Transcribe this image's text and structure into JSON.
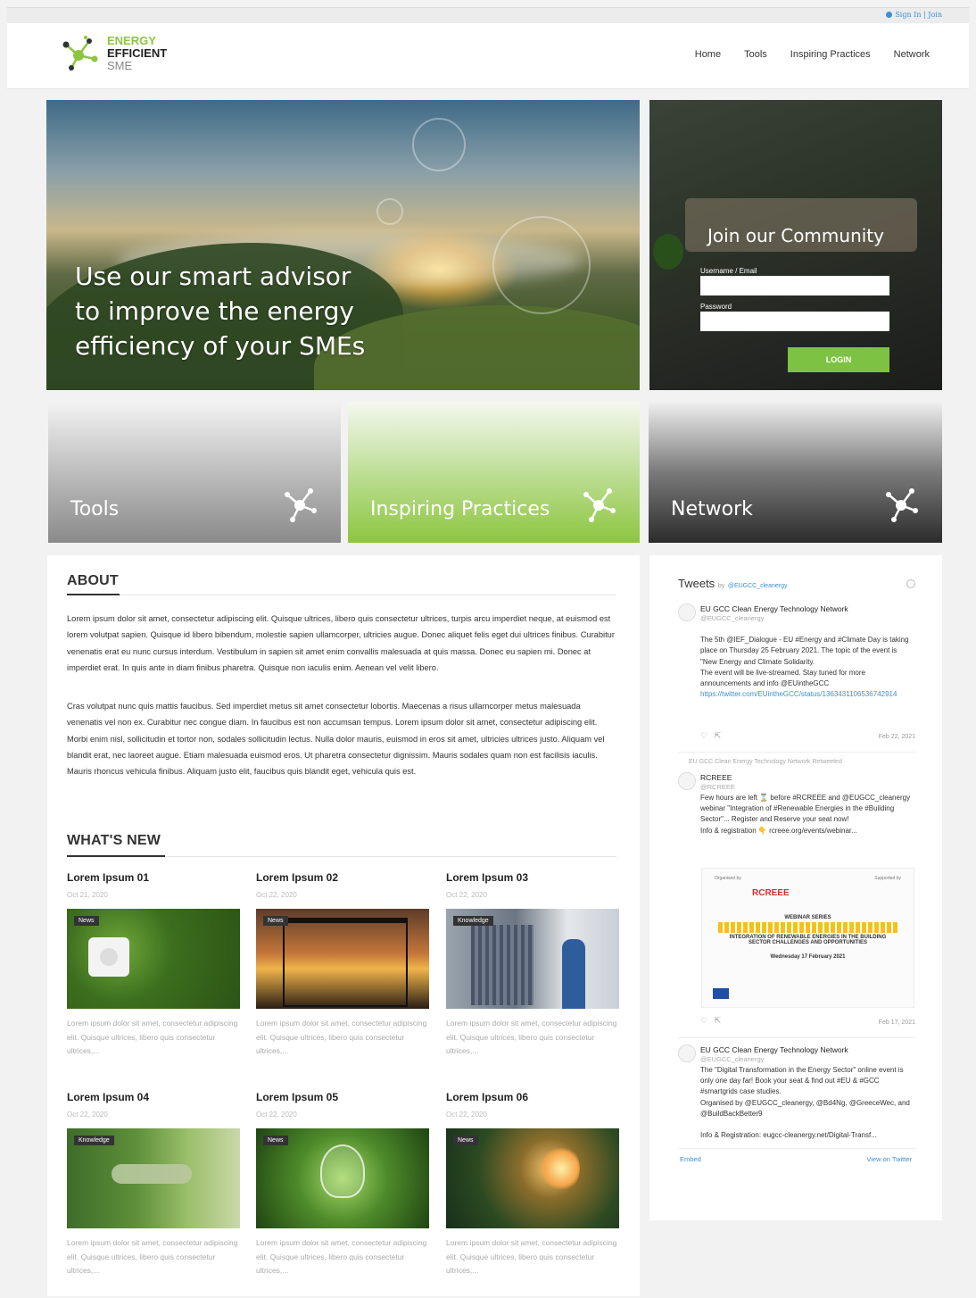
{
  "topbar": {
    "signin": "Sign In | Join"
  },
  "logo": {
    "line1": "ENERGY",
    "line2": "EFFICIENT",
    "line3": "SME"
  },
  "nav": [
    "Home",
    "Tools",
    "Inspiring Practices",
    "Network"
  ],
  "hero": {
    "text": "Use our smart advisor\nto improve the energy\nefficiency of your SMEs"
  },
  "join": {
    "title": "Join our Community",
    "username_label": "Username / Email",
    "password_label": "Password",
    "login": "LOGIN"
  },
  "tiles": [
    "Tools",
    "Inspiring Practices",
    "Network"
  ],
  "about": {
    "title": "ABOUT",
    "p1": "Lorem ipsum dolor sit amet, consectetur adipiscing elit. Quisque ultrices, libero quis consectetur ultrices, turpis arcu imperdiet neque, at euismod est lorem volutpat sapien. Quisque id libero bibendum, molestie sapien ullamcorper, ultricies augue. Donec aliquet felis eget dui ultrices finibus. Curabitur venenatis erat eu nunc cursus interdum. Vestibulum in sapien sit amet enim convallis malesuada at quis massa. Donec eu sapien mi. Donec at imperdiet erat. In quis ante in diam finibus pharetra. Quisque non iaculis enim. Aenean vel velit libero.",
    "p2": "Cras volutpat nunc quis mattis faucibus. Sed imperdiet metus sit amet consectetur lobortis. Maecenas a risus ullamcorper metus malesuada venenatis vel non ex. Curabitur nec congue diam. In faucibus est non accumsan tempus. Lorem ipsum dolor sit amet, consectetur adipiscing elit. Morbi enim nisl, sollicitudin et tortor non, sodales sollicitudin lectus. Nulla dolor mauris, euismod in eros sit amet, ultricies ultrices justo. Aliquam vel blandit erat, nec laoreet augue. Etiam malesuada euismod eros. Ut pharetra consectetur dignissim. Mauris sodales quam non est facilisis iaculis. Mauris rhoncus vehicula finibus. Aliquam justo elit, faucibus quis blandit eget, vehicula quis est."
  },
  "whats_new": {
    "title": "WHAT'S NEW",
    "items": [
      {
        "title": "Lorem Ipsum 01",
        "date": "Oct 21, 2020",
        "tag": "News",
        "text": "Lorem ipsum dolor sit amet, consectetur adipiscing elit. Quisque ultrices, libero quis consectetur ultrices,..."
      },
      {
        "title": "Lorem Ipsum 02",
        "date": "Oct 22, 2020",
        "tag": "News",
        "text": "Lorem ipsum dolor sit amet, consectetur adipiscing elit. Quisque ultrices, libero quis consectetur ultrices,..."
      },
      {
        "title": "Lorem Ipsum 03",
        "date": "Oct 22, 2020",
        "tag": "Knowledge",
        "text": "Lorem ipsum dolor sit amet, consectetur adipiscing elit. Quisque ultrices, libero quis consectetur ultrices,..."
      },
      {
        "title": "Lorem Ipsum 04",
        "date": "Oct 22, 2020",
        "tag": "Knowledge",
        "text": "Lorem ipsum dolor sit amet, consectetur adipiscing elit. Quisque ultrices, libero quis consectetur ultrices,..."
      },
      {
        "title": "Lorem Ipsum 05",
        "date": "Oct 22, 2020",
        "tag": "News",
        "text": "Lorem ipsum dolor sit amet, consectetur adipiscing elit. Quisque ultrices, libero quis consectetur ultrices,..."
      },
      {
        "title": "Lorem Ipsum 06",
        "date": "Oct 22, 2020",
        "tag": "News",
        "text": "Lorem ipsum dolor sit amet, consectetur adipiscing elit. Quisque ultrices, libero quis consectetur ultrices,..."
      }
    ]
  },
  "tweets": {
    "title": "Tweets",
    "by": "by",
    "account": "@EUGCC_cleanergy",
    "t1": {
      "name": "EU GCC Clean Energy Technology Network",
      "handle": "@EUGCC_cleanergy",
      "body": "The 5th @IEF_Dialogue - EU #Energy and #Climate Day is taking place on Thursday 25 February 2021. The topic of the event is \"New Energy and Climate Solidarity.\nThe event will be live-streamed. Stay tuned for more announcements and info @EUintheGCC",
      "link": "https://twitter.com/EUintheGCC/status/1363431106536742914",
      "date": "Feb 22, 2021"
    },
    "retweet": "EU GCC Clean Energy Technology Network Retweeted",
    "t2": {
      "name": "RCREEE",
      "handle": "@RCREEE",
      "body": "Few hours are left ⌛ before #RCREEE and @EUGCC_cleanergy webinar \"Integration of #Renewable Energies in the #Building Sector\"... Register and Reserve your seat now!\nInfo & registration 👇 rcreee.org/events/webinar...",
      "date": "Feb 17, 2021"
    },
    "webinar": {
      "organised": "Organised by",
      "supported": "Supported by",
      "brand": "RCREEE",
      "series": "WEBINAR SERIES",
      "subject": "INTEGRATION OF RENEWABLE ENERGIES IN THE BUILDING SECTOR CHALLENGES AND OPPORTUNITIES",
      "date": "Wednesday 17 February 2021"
    },
    "t3": {
      "name": "EU GCC Clean Energy Technology Network",
      "handle": "@EUGCC_cleanergy",
      "body": "The \"Digital Transformation in the Energy Sector\" online event is only one day far! Book your seat & find out #EU & #GCC #smartgrids case studies.\nOrganised by @EUGCC_cleanergy, @Bd4Ng, @GreeceWec, and @BuildBackBetter9\n\nInfo & Registration: eugcc-cleanergy.net/Digital-Transf..."
    },
    "embed": "Embed",
    "view": "View on Twitter"
  }
}
